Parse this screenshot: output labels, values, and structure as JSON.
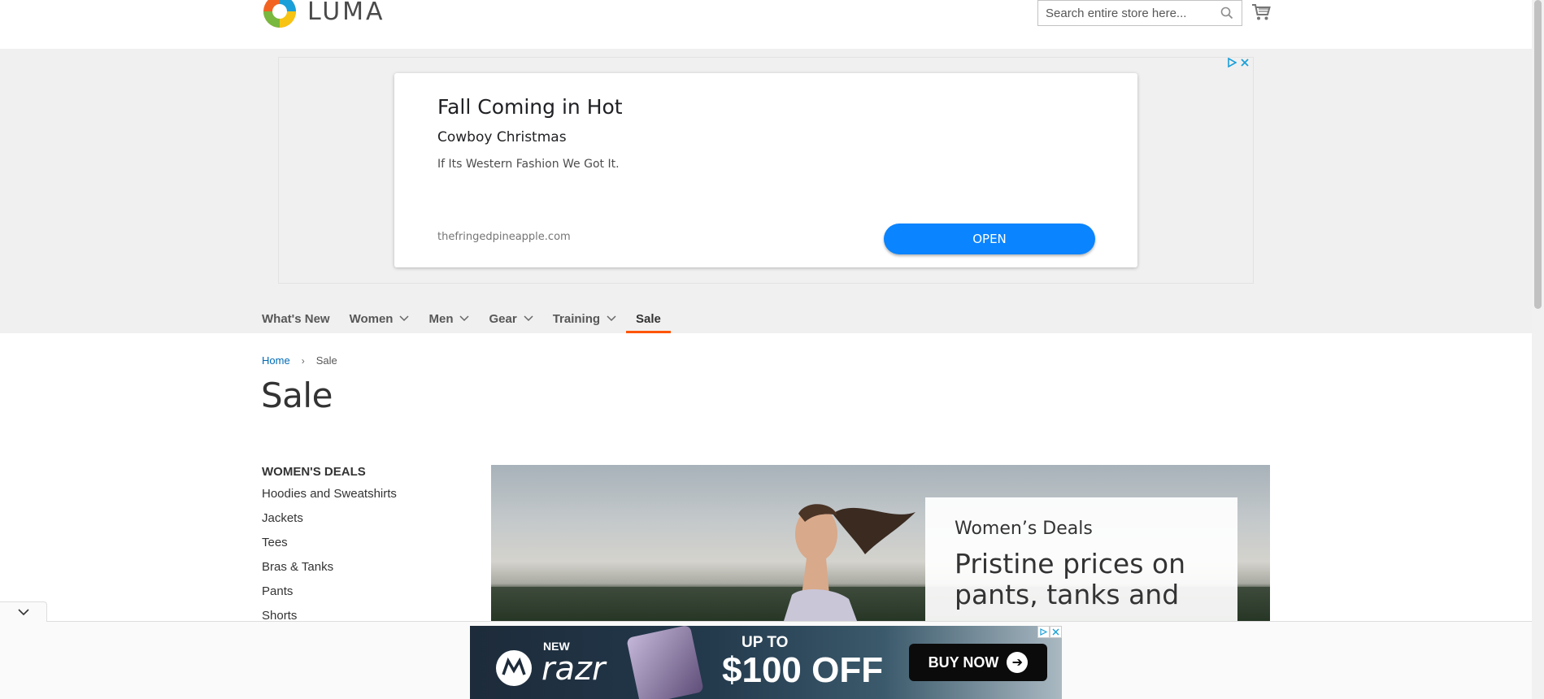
{
  "header": {
    "logo_text": "LUMA",
    "search_placeholder": "Search entire store here..."
  },
  "ad": {
    "title": "Fall Coming in Hot",
    "subtitle": "Cowboy Christmas",
    "description": "If Its Western Fashion We Got It.",
    "url": "thefringedpineapple.com",
    "button": "OPEN"
  },
  "nav": {
    "items": [
      {
        "label": "What's New",
        "has_dropdown": false
      },
      {
        "label": "Women",
        "has_dropdown": true
      },
      {
        "label": "Men",
        "has_dropdown": true
      },
      {
        "label": "Gear",
        "has_dropdown": true
      },
      {
        "label": "Training",
        "has_dropdown": true
      },
      {
        "label": "Sale",
        "has_dropdown": false,
        "active": true
      }
    ]
  },
  "breadcrumb": {
    "home": "Home",
    "separator": "›",
    "current": "Sale"
  },
  "page": {
    "title": "Sale"
  },
  "sidebar": {
    "title": "WOMEN'S DEALS",
    "links": [
      "Hoodies and Sweatshirts",
      "Jackets",
      "Tees",
      "Bras & Tanks",
      "Pants",
      "Shorts"
    ]
  },
  "hero": {
    "kicker": "Women’s Deals",
    "headline": "Pristine prices on pants, tanks and"
  },
  "bottom_ad": {
    "new": "NEW",
    "brand": "razr",
    "upto": "UP TO",
    "offer": "$100 OFF",
    "button": "BUY NOW"
  },
  "colors": {
    "accent": "#ff5501",
    "link": "#006bb4",
    "ad_button": "#0a84ff"
  }
}
